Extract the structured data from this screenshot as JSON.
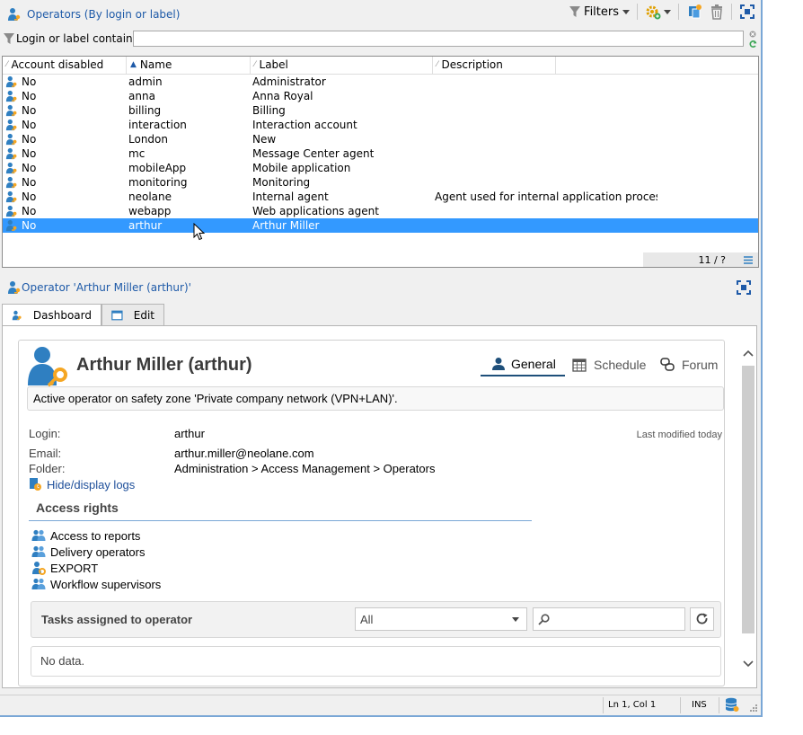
{
  "list_panel": {
    "title": "Operators (By login or label)",
    "filters_label": "Filters",
    "filter_label": "Login or label contains:",
    "filter_value": "",
    "columns": [
      "Account disabled",
      "Name",
      "Label",
      "Description"
    ],
    "rows": [
      {
        "disabled": "No",
        "name": "admin",
        "label": "Administrator",
        "description": ""
      },
      {
        "disabled": "No",
        "name": "anna",
        "label": "Anna Royal",
        "description": ""
      },
      {
        "disabled": "No",
        "name": "billing",
        "label": "Billing",
        "description": ""
      },
      {
        "disabled": "No",
        "name": "interaction",
        "label": "Interaction account",
        "description": ""
      },
      {
        "disabled": "No",
        "name": "London",
        "label": "New",
        "description": ""
      },
      {
        "disabled": "No",
        "name": "mc",
        "label": "Message Center agent",
        "description": ""
      },
      {
        "disabled": "No",
        "name": "mobileApp",
        "label": "Mobile application",
        "description": ""
      },
      {
        "disabled": "No",
        "name": "monitoring",
        "label": "Monitoring",
        "description": ""
      },
      {
        "disabled": "No",
        "name": "neolane",
        "label": "Internal agent",
        "description": "Agent used for internal application processes."
      },
      {
        "disabled": "No",
        "name": "webapp",
        "label": "Web applications agent",
        "description": ""
      },
      {
        "disabled": "No",
        "name": "arthur",
        "label": "Arthur Miller",
        "description": ""
      }
    ],
    "count": "11 / ?"
  },
  "detail_panel": {
    "title": "Operator 'Arthur Miller (arthur)'",
    "tabs": [
      "Dashboard",
      "Edit"
    ],
    "header_name": "Arthur Miller (arthur)",
    "subtabs": [
      "General",
      "Schedule",
      "Forum"
    ],
    "banner": "Active operator on safety zone 'Private company network (VPN+LAN)'.",
    "login_label": "Login:",
    "login_value": "arthur",
    "last_modified": "Last modified today",
    "email_label": "Email:",
    "email_value": "arthur.miller@neolane.com",
    "folder_label": "Folder:",
    "folder_value": "Administration > Access Management > Operators",
    "logs_link": "Hide/display logs",
    "access_rights_title": "Access rights",
    "access_rights": [
      "Access to reports",
      "Delivery operators",
      "EXPORT",
      "Workflow supervisors"
    ],
    "tasks_title": "Tasks assigned to operator",
    "tasks_filter": "All",
    "tasks_search": "",
    "no_data": "No data."
  },
  "status_bar": {
    "position": "Ln 1, Col 1",
    "mode": "INS"
  },
  "colors": {
    "accent": "#1e5aa8",
    "selection": "#3399ff",
    "icon_orange": "#f5a623",
    "icon_blue": "#2f7fc1"
  }
}
